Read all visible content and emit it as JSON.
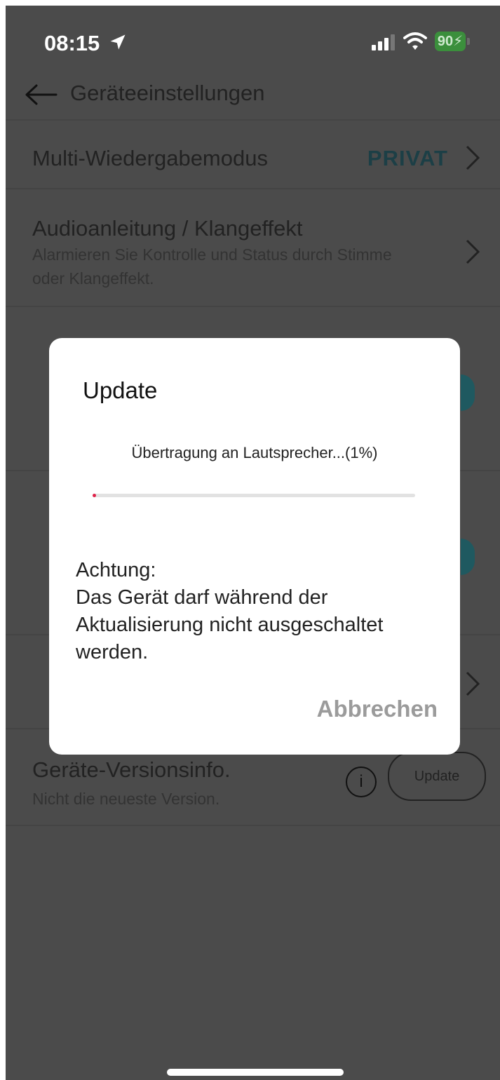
{
  "status_bar": {
    "time": "08:15",
    "battery": "90",
    "icons": [
      "location-arrow-icon",
      "cellular-signal-icon",
      "wifi-icon",
      "battery-charging-icon"
    ]
  },
  "header": {
    "title": "Geräteeinstellungen",
    "back_icon": "arrow-left-icon"
  },
  "settings": {
    "multi": {
      "title": "Multi-Wiedergabemodus",
      "value": "PRIVAT"
    },
    "audio": {
      "title": "Audioanleitung / Klangeffekt",
      "subtitle": "Alarmieren Sie Kontrolle und Status durch Stimme oder Klangeffekt."
    },
    "version": {
      "title": "Geräte-Versionsinfo.",
      "subtitle": "Nicht die neueste Version.",
      "button": "Update",
      "info_icon": "i"
    }
  },
  "modal": {
    "title": "Update",
    "progress_text": "Übertragung an Lautsprecher...(1%)",
    "progress": 0.01,
    "warning": "Achtung:\nDas Gerät darf während der Aktualisierung nicht ausgeschaltet werden.",
    "cancel": "Abbrechen"
  },
  "colors": {
    "overlay_bg": "#4b4b4b",
    "accent": "#1f5960",
    "progress": "#e0234a"
  }
}
